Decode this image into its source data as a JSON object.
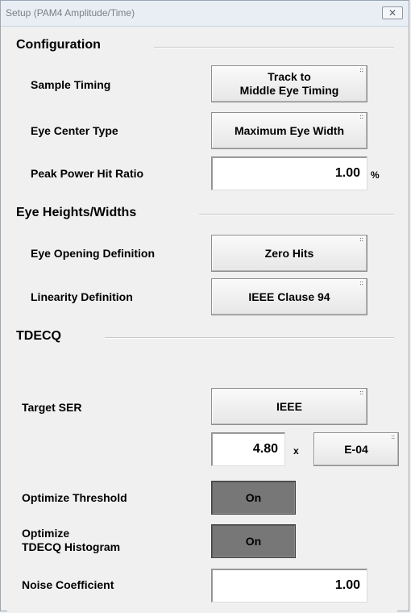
{
  "window": {
    "title": "Setup (PAM4 Amplitude/Time)",
    "close_glyph": "✕"
  },
  "configuration": {
    "heading": "Configuration",
    "sample_timing": {
      "label": "Sample Timing",
      "value_line1": "Track to",
      "value_line2": "Middle Eye Timing"
    },
    "eye_center_type": {
      "label": "Eye Center Type",
      "value": "Maximum Eye Width"
    },
    "peak_power_hit_ratio": {
      "label": "Peak Power Hit Ratio",
      "value": "1.00",
      "unit": "%"
    }
  },
  "eye_heights_widths": {
    "heading": "Eye Heights/Widths",
    "eye_opening_definition": {
      "label": "Eye Opening Definition",
      "value": "Zero Hits"
    },
    "linearity_definition": {
      "label": "Linearity Definition",
      "value": "IEEE Clause 94"
    }
  },
  "tdecq": {
    "heading": "TDECQ",
    "target_ser": {
      "label": "Target SER",
      "value": "IEEE",
      "mantissa": "4.80",
      "times": "x",
      "exponent": "E-04"
    },
    "optimize_threshold": {
      "label": "Optimize Threshold",
      "value": "On"
    },
    "optimize_histogram": {
      "label_line1": "Optimize",
      "label_line2": "TDECQ Histogram",
      "value": "On"
    },
    "noise_coefficient": {
      "label": "Noise Coefficient",
      "value": "1.00"
    }
  },
  "dropdown_indicator": "::"
}
